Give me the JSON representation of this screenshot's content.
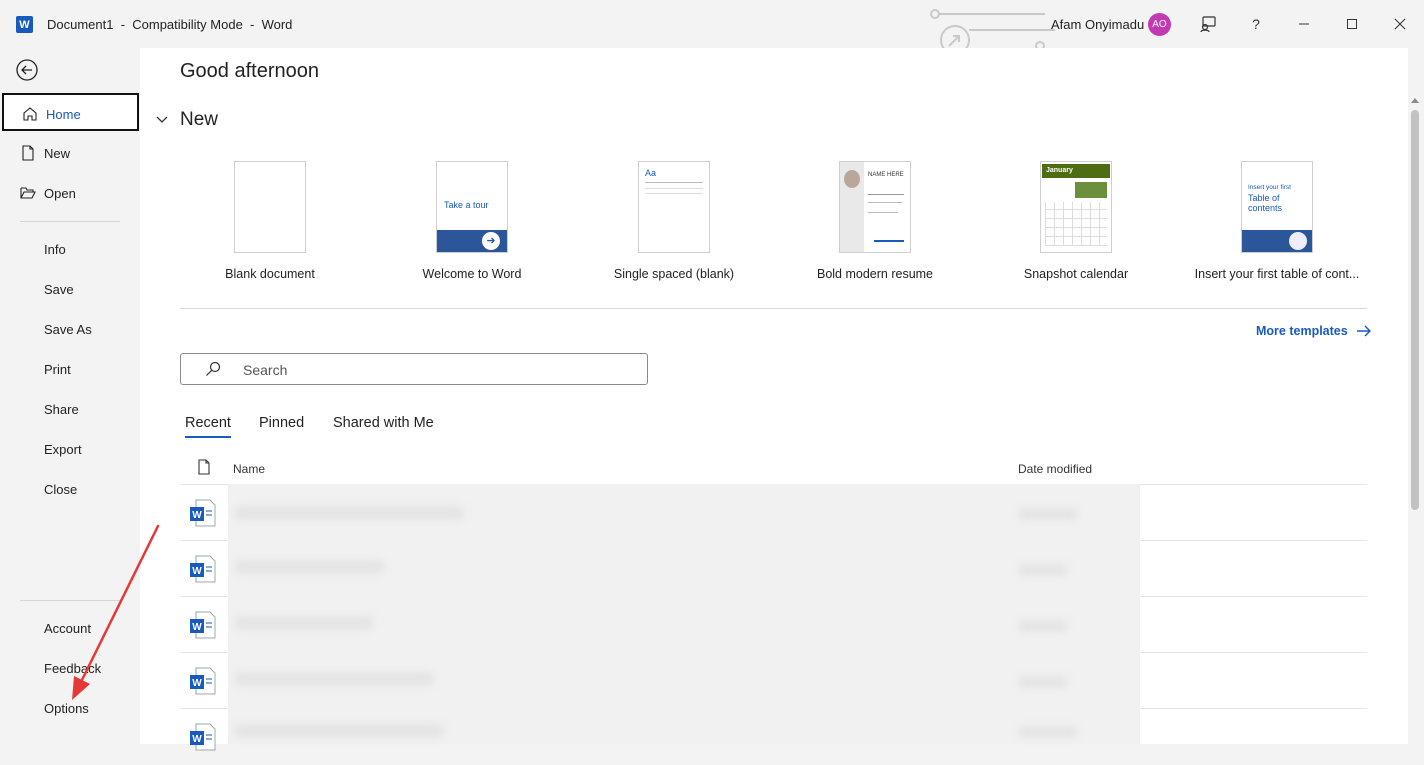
{
  "titlebar": {
    "app_logo": "W",
    "document_title": "Document1  -  Compatibility Mode  -  Word",
    "user_name": "Afam Onyimadu",
    "user_initials": "AO",
    "help_label": "?"
  },
  "sidebar": {
    "items": [
      {
        "label": "Home",
        "icon": "home-icon"
      },
      {
        "label": "New",
        "icon": "new-document-icon"
      },
      {
        "label": "Open",
        "icon": "folder-open-icon"
      },
      {
        "label": "Info"
      },
      {
        "label": "Save"
      },
      {
        "label": "Save As"
      },
      {
        "label": "Print"
      },
      {
        "label": "Share"
      },
      {
        "label": "Export"
      },
      {
        "label": "Close"
      },
      {
        "label": "Account"
      },
      {
        "label": "Feedback"
      },
      {
        "label": "Options"
      }
    ],
    "active": "Home"
  },
  "main": {
    "greeting": "Good afternoon",
    "new_section": "New",
    "templates": [
      {
        "caption": "Blank document"
      },
      {
        "caption": "Welcome to Word",
        "thumb_text": "Take a tour"
      },
      {
        "caption": "Single spaced (blank)",
        "thumb_text": "Aa"
      },
      {
        "caption": "Bold modern resume",
        "thumb_text": "NAME HERE"
      },
      {
        "caption": "Snapshot calendar",
        "thumb_text": "January"
      },
      {
        "caption": "Insert your first table of cont...",
        "thumb_text_1": "Insert your first",
        "thumb_text_2": "Table of contents"
      }
    ],
    "more_templates": "More templates",
    "search_placeholder": "Search",
    "tabs": [
      "Recent",
      "Pinned",
      "Shared with Me"
    ],
    "active_tab": "Recent",
    "columns": {
      "name": "Name",
      "date_modified": "Date modified"
    }
  },
  "colors": {
    "accent": "#185abd",
    "avatar": "#c239b3",
    "annotation_arrow": "#e53935"
  }
}
